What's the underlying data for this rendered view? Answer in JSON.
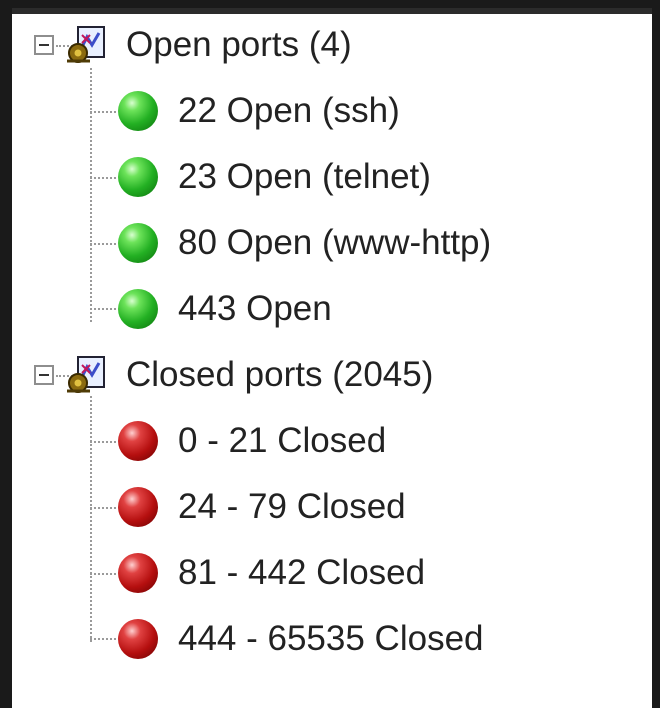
{
  "tree": {
    "groups": [
      {
        "label": "Open ports (4)",
        "status_color": "#2eb82e",
        "items": [
          {
            "label": "22 Open (ssh)"
          },
          {
            "label": "23 Open (telnet)"
          },
          {
            "label": "80 Open (www-http)"
          },
          {
            "label": "443 Open"
          }
        ]
      },
      {
        "label": "Closed ports (2045)",
        "status_color": "#c01515",
        "items": [
          {
            "label": "0 - 21 Closed"
          },
          {
            "label": "24 - 79 Closed"
          },
          {
            "label": "81 - 442 Closed"
          },
          {
            "label": "444 - 65535 Closed"
          }
        ]
      }
    ],
    "icons": {
      "expander": "collapse-minus-icon",
      "group": "port-group-icon",
      "open": "green-status-dot-icon",
      "closed": "red-status-dot-icon"
    }
  }
}
